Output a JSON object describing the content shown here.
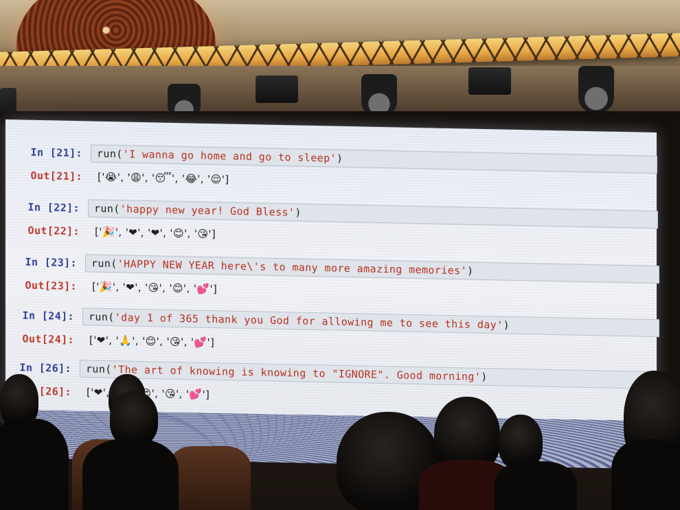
{
  "notebook": {
    "cells": [
      {
        "in_prompt": "In [21]:",
        "code_prefix": "run(",
        "code_string": "'I wanna go home and go to sleep'",
        "code_suffix": ")",
        "out_prompt": "Out[21]:",
        "output": "['😭', '😩', '😴', '😂', '😌']"
      },
      {
        "in_prompt": "In [22]:",
        "code_prefix": "run(",
        "code_string": "'happy new year! God Bless'",
        "code_suffix": ")",
        "out_prompt": "Out[22]:",
        "output": "['🎉', '❤', '❤', '😊', '😘']"
      },
      {
        "in_prompt": "In [23]:",
        "code_prefix": "run(",
        "code_string": "'HAPPY NEW YEAR here\\'s to many more amazing memories'",
        "code_suffix": ")",
        "out_prompt": "Out[23]:",
        "output": "['🎉', '❤', '😘', '😊', '💕']"
      },
      {
        "in_prompt": "In [24]:",
        "code_prefix": "run(",
        "code_string": "'day 1 of 365 thank you God for allowing me to see this day'",
        "code_suffix": ")",
        "out_prompt": "Out[24]:",
        "output": "['❤', '🙏', '😊', '😘', '💕']"
      },
      {
        "in_prompt": "In [26]:",
        "code_prefix": "run(",
        "code_string": "'The art of knowing is knowing to \"IGNORE\". Good morning'",
        "code_suffix": ")",
        "out_prompt": "[26]:",
        "output": "['❤', '😊', '😍', '😘', '💕']"
      }
    ]
  },
  "colors": {
    "in_prompt": "#30409a",
    "out_prompt": "#c0392b",
    "string_literal": "#b8321f",
    "code_background": "#dfe3ea"
  }
}
